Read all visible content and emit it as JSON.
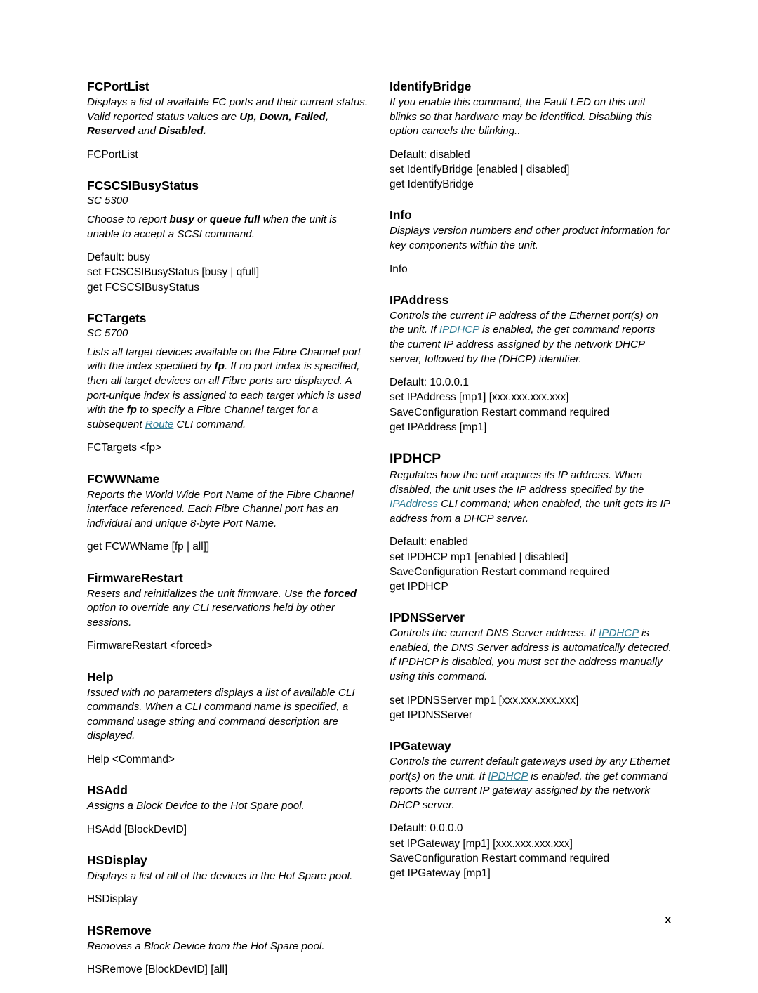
{
  "document": {
    "page_number": "x",
    "link_color": "#2e7c94"
  },
  "left_column": [
    {
      "title": "FCPortList",
      "sc": "",
      "desc_html": "Displays a list of available FC ports and their current status. Valid reported status values are <b>Up, Down, Failed, Reserved</b> and <b>Disabled.</b>",
      "usage": "FCPortList"
    },
    {
      "title": "FCSCSIBusyStatus",
      "sc": "SC 5300",
      "desc_html": "Choose to report <b>busy</b> or <b>queue full</b> when the unit is unable to accept a SCSI command.",
      "usage": "Default: busy\nset FCSCSIBusyStatus [busy | qfull]\nget FCSCSIBusyStatus"
    },
    {
      "title": "FCTargets",
      "sc": "SC 5700",
      "desc_html": "Lists all target devices available on the Fibre Channel port with the index specified by <b>fp</b>. If no port index is specified, then all target devices on all Fibre ports are displayed. A port-unique index is assigned to each target which is used with the <b>fp</b> to specify a Fibre Channel target for a subsequent <span class=\"lnk\">Route</span> CLI command.",
      "usage": "FCTargets <fp>"
    },
    {
      "title": "FCWWName",
      "sc": "",
      "desc_html": "Reports the World Wide Port Name of the Fibre Channel interface referenced. Each Fibre Channel port has an individual and unique 8-byte Port Name.",
      "usage": "get FCWWName [fp | all]]"
    },
    {
      "title": "FirmwareRestart",
      "sc": "",
      "desc_html": "Resets and reinitializes the unit firmware. Use the <b>forced</b> option to override any CLI reservations held by other sessions.",
      "usage": "FirmwareRestart <forced>"
    },
    {
      "title": "Help",
      "sc": "",
      "desc_html": "Issued with no parameters displays a list of available CLI commands. When a CLI command name is specified, a command usage string and command description are displayed.",
      "usage": "Help <Command>"
    },
    {
      "title": "HSAdd",
      "sc": "",
      "desc_html": "Assigns a Block Device to the Hot Spare pool.",
      "usage": "HSAdd [BlockDevID]"
    },
    {
      "title": "HSDisplay",
      "sc": "",
      "desc_html": "Displays a list of all of the devices in the Hot Spare pool.",
      "usage": "HSDisplay"
    },
    {
      "title": "HSRemove",
      "sc": "",
      "desc_html": "Removes a Block Device from the Hot Spare pool.",
      "usage": "HSRemove [BlockDevID] [all]"
    }
  ],
  "right_column": [
    {
      "title": "IdentifyBridge",
      "sc": "",
      "desc_html": "If you enable this command, the Fault LED on this unit blinks so that hardware may be identified. Disabling this option cancels the blinking..",
      "usage": "Default: disabled\nset IdentifyBridge [enabled | disabled]\nget IdentifyBridge"
    },
    {
      "title": "Info",
      "sc": "",
      "desc_html": "Displays version numbers and other product information for key components within the unit.",
      "usage": "Info"
    },
    {
      "title": "IPAddress",
      "sc": "",
      "desc_html": "Controls the current IP address of the Ethernet port(s) on the unit. If <span class=\"lnk\">IPDHCP</span> is enabled, the get command reports the current IP address assigned by the network DHCP server, followed by the (DHCP) identifier.",
      "usage": "Default: 10.0.0.1\nset IPAddress [mp1] [xxx.xxx.xxx.xxx]\nSaveConfiguration Restart command required\nget IPAddress [mp1]"
    },
    {
      "title": "IPDHCP",
      "sc": "",
      "desc_html": "Regulates how the unit acquires its IP address. When disabled, the unit uses the IP address specified by the <span class=\"lnk\">IPAddress</span> CLI command; when enabled, the unit gets its IP address from a DHCP server.",
      "usage": "Default: enabled\nset IPDHCP mp1 [enabled | disabled]\nSaveConfiguration Restart command required\nget IPDHCP"
    },
    {
      "title": "IPDNSServer",
      "sc": "",
      "desc_html": "Controls the current DNS Server address. If <span class=\"lnk\">IPDHCP</span> is enabled, the DNS Server address is automatically detected. If IPDHCP is disabled, you must set the address manually using this command.",
      "usage": "set IPDNSServer mp1 [xxx.xxx.xxx.xxx]\nget IPDNSServer"
    },
    {
      "title": "IPGateway",
      "sc": "",
      "desc_html": "Controls the current default gateways used by any Ethernet port(s) on the unit. If <span class=\"lnk\">IPDHCP</span> is enabled, the get command reports the current IP gateway assigned by the network DHCP server.",
      "usage": "Default: 0.0.0.0\nset IPGateway [mp1] [xxx.xxx.xxx.xxx]\nSaveConfiguration Restart command required\nget IPGateway [mp1]"
    }
  ]
}
